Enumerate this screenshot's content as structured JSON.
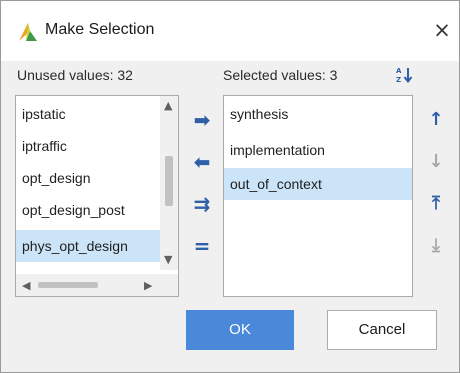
{
  "window": {
    "title": "Make Selection",
    "close_glyph": "×",
    "app_icon": "vivado-logo-icon",
    "accent_color": "#2f5fa7"
  },
  "unused": {
    "label": "Unused values: 32",
    "items": [
      "ipstatic",
      "iptraffic",
      "opt_design",
      "opt_design_post",
      "phys_opt_design"
    ],
    "selected_item": "phys_opt_design"
  },
  "selected": {
    "label": "Selected values: 3",
    "items": [
      "synthesis",
      "implementation",
      "out_of_context"
    ],
    "selected_item": "out_of_context"
  },
  "controls": {
    "sort_icon": "sort-alpha-icon",
    "add_glyph": "➡",
    "remove_glyph": "⬅",
    "add_all_glyph": "⇉",
    "remove_all_glyph": "="
  },
  "reorder": {
    "up_glyph": "↑",
    "down_glyph": "↓",
    "top_glyph": "⤒",
    "bottom_glyph": "⤓"
  },
  "buttons": {
    "ok_label": "OK",
    "cancel_label": "Cancel"
  }
}
